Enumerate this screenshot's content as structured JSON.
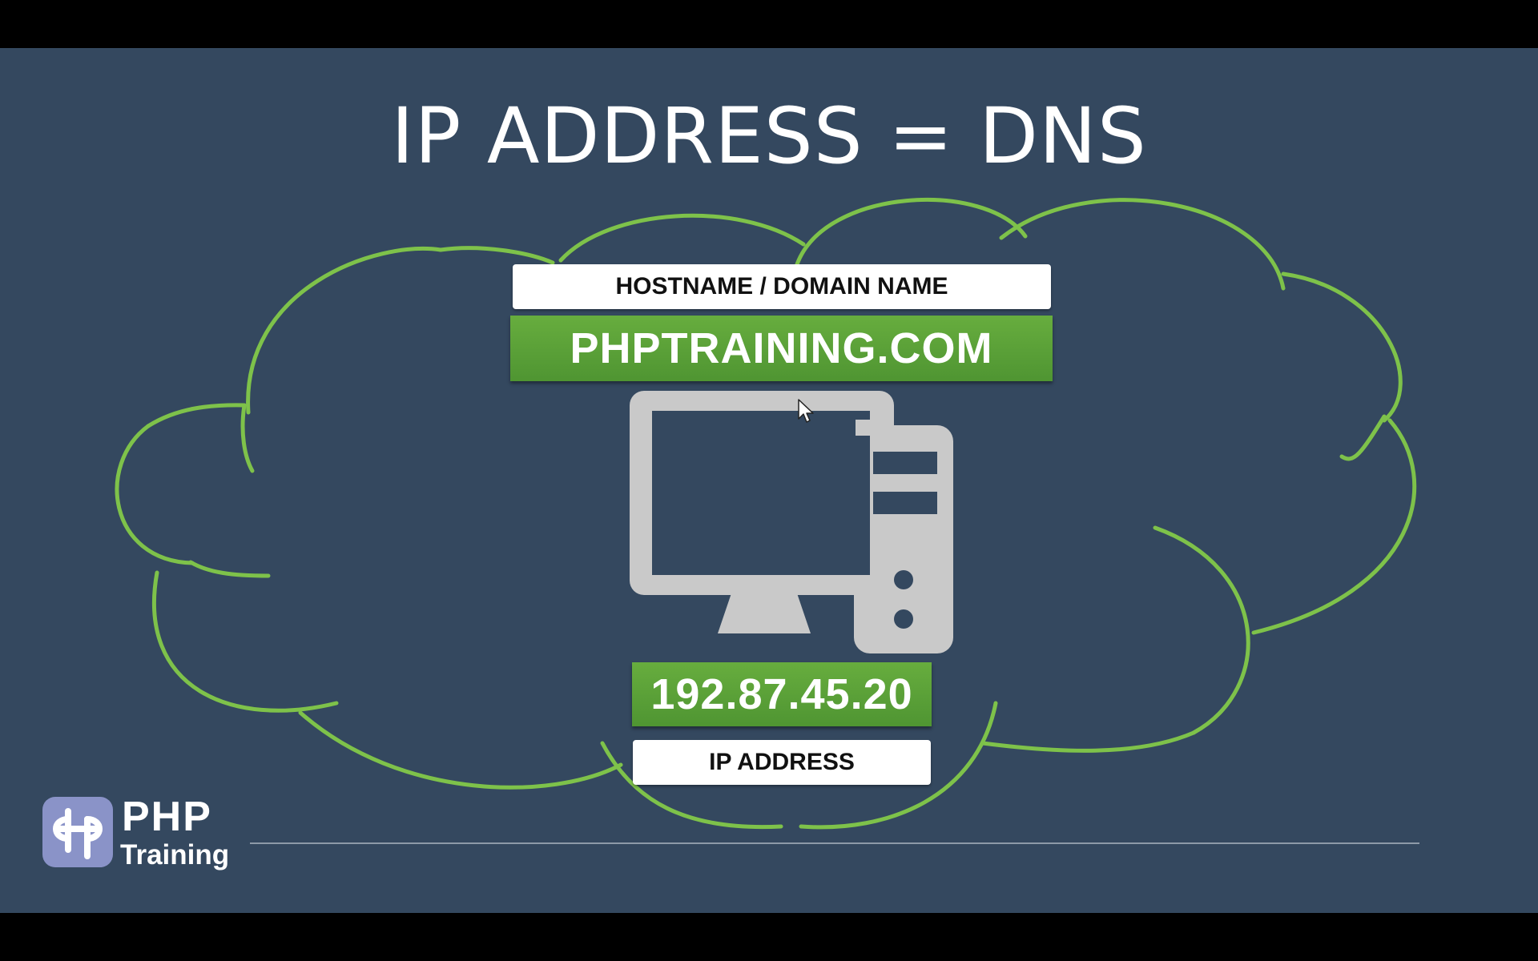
{
  "slide": {
    "title": "IP ADDRESS = DNS",
    "background_color": "#34485f",
    "accent_color": "#5da038",
    "cloud_stroke_color": "#7ec24a"
  },
  "diagram": {
    "hostname_label": "HOSTNAME / DOMAIN NAME",
    "domain_value": "PHPTRAINING.COM",
    "ip_value": "192.87.45.20",
    "ip_label": "IP ADDRESS",
    "center_icon": "desktop-computer-icon"
  },
  "branding": {
    "logo_icon": "php-training-logo-icon",
    "logo_name": "PHP",
    "logo_sub": "Training"
  }
}
